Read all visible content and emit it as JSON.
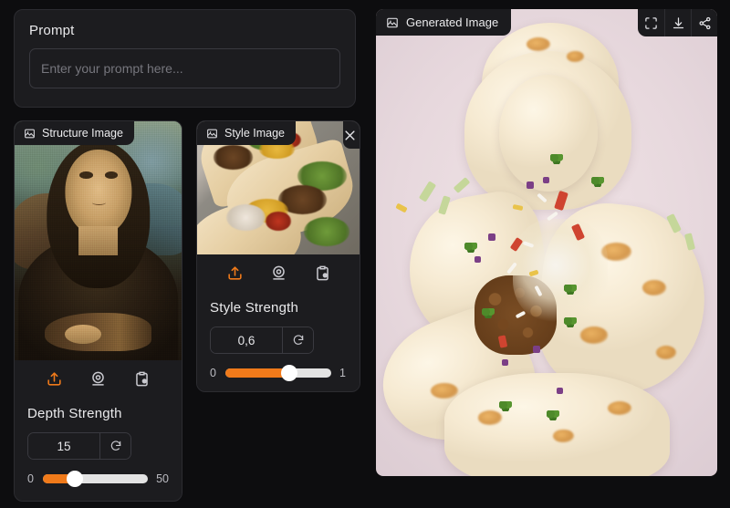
{
  "theme": {
    "page_bg": "#0d0d0f",
    "panel_bg": "#1c1c1f",
    "panel_border": "#2c2c31",
    "accent": "#f07a1a",
    "slider_track": "#e3e3e3",
    "text_primary": "#eaeaec",
    "text_muted": "#76767d"
  },
  "prompt": {
    "label": "Prompt",
    "placeholder": "Enter your prompt here...",
    "value": ""
  },
  "structure_card": {
    "badge_label": "Structure Image",
    "badge_icon": "image-icon",
    "actions": [
      {
        "name": "upload-icon",
        "label": "Upload"
      },
      {
        "name": "webcam-icon",
        "label": "Webcam"
      },
      {
        "name": "paste-clipboard-icon",
        "label": "Paste"
      }
    ],
    "strength": {
      "title": "Depth Strength",
      "value": "15",
      "reset_icon": "reset-icon",
      "min_label": "0",
      "max_label": "50",
      "min": 0,
      "max": 50,
      "current": 15,
      "fill_percent": 30
    }
  },
  "style_card": {
    "badge_label": "Style Image",
    "badge_icon": "image-icon",
    "close_icon": "close-icon",
    "actions": [
      {
        "name": "upload-icon",
        "label": "Upload"
      },
      {
        "name": "webcam-icon",
        "label": "Webcam"
      },
      {
        "name": "paste-clipboard-icon",
        "label": "Paste"
      }
    ],
    "strength": {
      "title": "Style Strength",
      "value": "0,6",
      "reset_icon": "reset-icon",
      "min_label": "0",
      "max_label": "1",
      "min": 0,
      "max": 1,
      "current": 0.6,
      "fill_percent": 60
    }
  },
  "generated": {
    "badge_label": "Generated Image",
    "badge_icon": "image-icon",
    "toolbar": [
      {
        "name": "fullscreen-icon",
        "label": "Fullscreen"
      },
      {
        "name": "download-icon",
        "label": "Download"
      },
      {
        "name": "share-icon",
        "label": "Share"
      }
    ]
  }
}
